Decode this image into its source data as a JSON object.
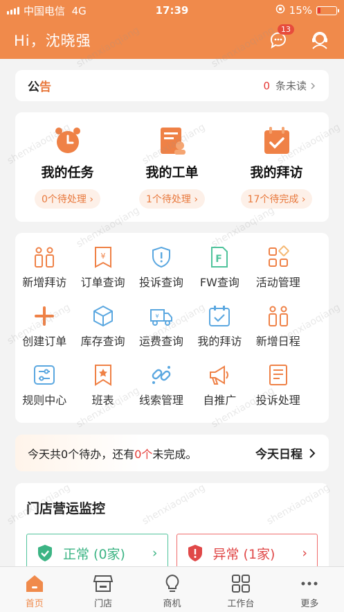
{
  "status": {
    "carrier": "中国电信",
    "network": "4G",
    "time": "17:39",
    "battery": "15%",
    "battery_level": 0.15
  },
  "header": {
    "greeting": "Hi，沈晓强",
    "message_badge": "13"
  },
  "notice": {
    "title_a": "公",
    "title_b": "告",
    "unread_count": "0",
    "unread_label": "条未读"
  },
  "main": [
    {
      "label": "我的任务",
      "pill": "0个待处理",
      "icon": "alarm-clock-icon"
    },
    {
      "label": "我的工单",
      "pill": "1个待处理",
      "icon": "work-order-icon"
    },
    {
      "label": "我的拜访",
      "pill": "17个待完成",
      "icon": "calendar-check-icon"
    }
  ],
  "grid": [
    {
      "label": "新增拜访",
      "icon": "people-icon"
    },
    {
      "label": "订单查询",
      "icon": "receipt-icon"
    },
    {
      "label": "投诉查询",
      "icon": "shield-alert-icon"
    },
    {
      "label": "FW查询",
      "icon": "fw-document-icon"
    },
    {
      "label": "活动管理",
      "icon": "apps-icon"
    },
    {
      "label": "创建订单",
      "icon": "plus-icon"
    },
    {
      "label": "库存查询",
      "icon": "box-icon"
    },
    {
      "label": "运费查询",
      "icon": "truck-icon"
    },
    {
      "label": "我的拜访",
      "icon": "calendar-check-icon"
    },
    {
      "label": "新增日程",
      "icon": "people-icon"
    },
    {
      "label": "规则中心",
      "icon": "sliders-icon"
    },
    {
      "label": "班表",
      "icon": "bookmark-star-icon"
    },
    {
      "label": "线索管理",
      "icon": "link-icon"
    },
    {
      "label": "自推广",
      "icon": "megaphone-icon"
    },
    {
      "label": "投诉处理",
      "icon": "list-document-icon"
    }
  ],
  "today": {
    "prefix": "今天共",
    "todo_count": "0",
    "mid": "个待办，还有",
    "undone_count": "0",
    "undone_unit": "个",
    "suffix": "未完成。",
    "link": "今天日程"
  },
  "monitor": {
    "title": "门店营运监控",
    "normal": "正常 (0家)",
    "abnormal": "异常 (1家)"
  },
  "tabs": [
    {
      "label": "首页",
      "icon": "home-icon"
    },
    {
      "label": "门店",
      "icon": "store-icon"
    },
    {
      "label": "商机",
      "icon": "lightbulb-icon"
    },
    {
      "label": "工作台",
      "icon": "grid-icon"
    },
    {
      "label": "更多",
      "icon": "more-icon"
    }
  ],
  "watermark": "shenxiaoqiang",
  "colors": {
    "accent": "#f08a4b",
    "red": "#e53935",
    "green": "#3cb484",
    "icon_blue": "#5aa7e0"
  }
}
